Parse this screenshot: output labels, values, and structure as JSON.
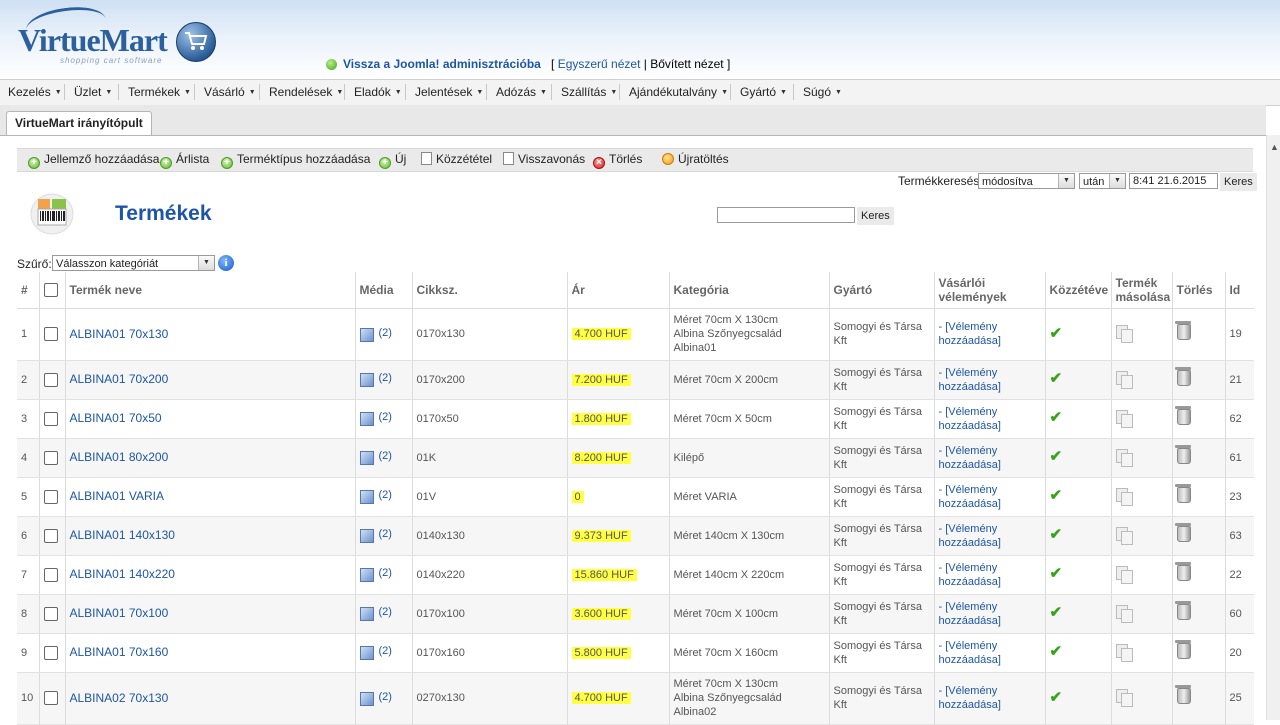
{
  "header": {
    "logo_text_a": "Virtue",
    "logo_text_b": "Mart",
    "logo_tagline": "shopping cart software",
    "joomla_link": "Vissza a Joomla! adminisztrációba",
    "view_open": "[",
    "view_simple": "Egyszerű nézet",
    "view_sep": "|",
    "view_advanced": "Bővített nézet",
    "view_close": "]"
  },
  "menu": [
    "Kezelés",
    "Üzlet",
    "Termékek",
    "Vásárló",
    "Rendelések",
    "Eladók",
    "Jelentések",
    "Adózás",
    "Szállítás",
    "Ajándékutalvány",
    "Gyártó",
    "Súgó"
  ],
  "tab": "VirtueMart irányítópult",
  "toolbar": {
    "add_attribute": "Jellemző hozzáadása",
    "pricelist": "Árlista",
    "add_product_type": "Terméktípus hozzáadása",
    "new": "Új",
    "publish": "Közzététel",
    "unpublish": "Visszavonás",
    "delete": "Törlés",
    "reload": "Újratöltés"
  },
  "product_search": {
    "label": "Termékkeresés",
    "modified": "módosítva",
    "after": "után",
    "datetime": "8:41 21.6.2015",
    "button": "Keres"
  },
  "page": {
    "title": "Termékek",
    "search_value": "",
    "search_button": "Keres",
    "filter_label": "Szűrő:",
    "category_select": "Válasszon kategóriát"
  },
  "table": {
    "headers": {
      "num": "#",
      "name": "Termék neve",
      "media": "Média",
      "sku": "Cikksz.",
      "price": "Ár",
      "category": "Kategória",
      "manufacturer": "Gyártó",
      "reviews": "Vásárlói vélemények",
      "published": "Közzétéve",
      "copy": "Termék másolása",
      "delete": "Törlés",
      "id": "Id"
    },
    "rows": [
      {
        "num": "1",
        "name": "ALBINA01 70x130",
        "media": "(2)",
        "sku": "0170x130",
        "price": "4.700 HUF",
        "category": "Méret 70cm X 130cm\nAlbina Szőnyegcsalád\nAlbina01",
        "manufacturer": "Somogyi és Társa Kft",
        "review": "- [Vélemény hozzáadása]",
        "id": "19"
      },
      {
        "num": "2",
        "name": "ALBINA01 70x200",
        "media": "(2)",
        "sku": "0170x200",
        "price": "7.200 HUF",
        "category": "Méret 70cm X 200cm",
        "manufacturer": "Somogyi és Társa Kft",
        "review": "- [Vélemény hozzáadása]",
        "id": "21"
      },
      {
        "num": "3",
        "name": "ALBINA01 70x50",
        "media": "(2)",
        "sku": "0170x50",
        "price": "1.800 HUF",
        "category": "Méret 70cm X 50cm",
        "manufacturer": "Somogyi és Társa Kft",
        "review": "- [Vélemény hozzáadása]",
        "id": "62"
      },
      {
        "num": "4",
        "name": "ALBINA01 80x200",
        "media": "(2)",
        "sku": "01K",
        "price": "8.200 HUF",
        "category": "Kilépő",
        "manufacturer": "Somogyi és Társa Kft",
        "review": "- [Vélemény hozzáadása]",
        "id": "61"
      },
      {
        "num": "5",
        "name": "ALBINA01 VARIA",
        "media": "(2)",
        "sku": "01V",
        "price": "0",
        "category": "Méret VARIA",
        "manufacturer": "Somogyi és Társa Kft",
        "review": "- [Vélemény hozzáadása]",
        "id": "23"
      },
      {
        "num": "6",
        "name": "ALBINA01 140x130",
        "media": "(2)",
        "sku": "0140x130",
        "price": "9.373 HUF",
        "category": "Méret 140cm X 130cm",
        "manufacturer": "Somogyi és Társa Kft",
        "review": "- [Vélemény hozzáadása]",
        "id": "63"
      },
      {
        "num": "7",
        "name": "ALBINA01 140x220",
        "media": "(2)",
        "sku": "0140x220",
        "price": "15.860 HUF",
        "category": "Méret 140cm X 220cm",
        "manufacturer": "Somogyi és Társa Kft",
        "review": "- [Vélemény hozzáadása]",
        "id": "22"
      },
      {
        "num": "8",
        "name": "ALBINA01 70x100",
        "media": "(2)",
        "sku": "0170x100",
        "price": "3.600 HUF",
        "category": "Méret 70cm X 100cm",
        "manufacturer": "Somogyi és Társa Kft",
        "review": "- [Vélemény hozzáadása]",
        "id": "60"
      },
      {
        "num": "9",
        "name": "ALBINA01 70x160",
        "media": "(2)",
        "sku": "0170x160",
        "price": "5.800 HUF",
        "category": "Méret 70cm X 160cm",
        "manufacturer": "Somogyi és Társa Kft",
        "review": "- [Vélemény hozzáadása]",
        "id": "20"
      },
      {
        "num": "10",
        "name": "ALBINA02 70x130",
        "media": "(2)",
        "sku": "0270x130",
        "price": "4.700 HUF",
        "category": "Méret 70cm X 130cm\nAlbina Szőnyegcsalád\nAlbina02",
        "manufacturer": "Somogyi és Társa Kft",
        "review": "- [Vélemény hozzáadása]",
        "id": "25"
      }
    ]
  },
  "colors": {
    "link": "#1d56a5",
    "price_highlight": "#ffff44",
    "published": "#3aa31c"
  }
}
